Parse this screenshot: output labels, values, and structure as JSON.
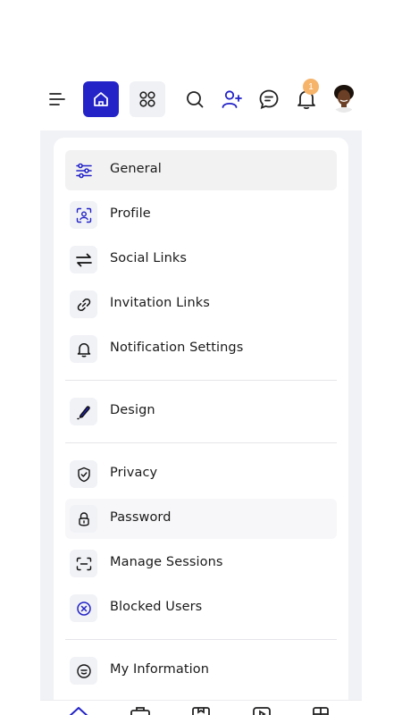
{
  "topbar": {
    "notification_count": "1",
    "icons": [
      "menu-icon",
      "home-icon",
      "apps-icon",
      "search-icon",
      "add-user-icon",
      "chat-icon",
      "bell-icon"
    ]
  },
  "menu": {
    "items": [
      {
        "label": "General",
        "icon": "sliders-icon",
        "active": true
      },
      {
        "label": "Profile",
        "icon": "profile-icon"
      },
      {
        "label": "Social Links",
        "icon": "swap-arrows-icon"
      },
      {
        "label": "Invitation Links",
        "icon": "link-icon"
      },
      {
        "label": "Notification Settings",
        "icon": "bell-icon"
      },
      {
        "label": "Design",
        "icon": "pen-icon"
      },
      {
        "label": "Privacy",
        "icon": "shield-check-icon"
      },
      {
        "label": "Password",
        "icon": "lock-icon"
      },
      {
        "label": "Manage Sessions",
        "icon": "sessions-icon"
      },
      {
        "label": "Blocked Users",
        "icon": "blocked-icon"
      },
      {
        "label": "My Information",
        "icon": "info-face-icon"
      }
    ]
  },
  "bottom_nav": {
    "icons": [
      "home-icon",
      "briefcase-icon",
      "bookmark-icon",
      "play-icon",
      "grid-icon"
    ]
  },
  "colors": {
    "accent": "#2323c8",
    "badge": "#f6b46a",
    "panel_bg": "#f1f2f6"
  }
}
